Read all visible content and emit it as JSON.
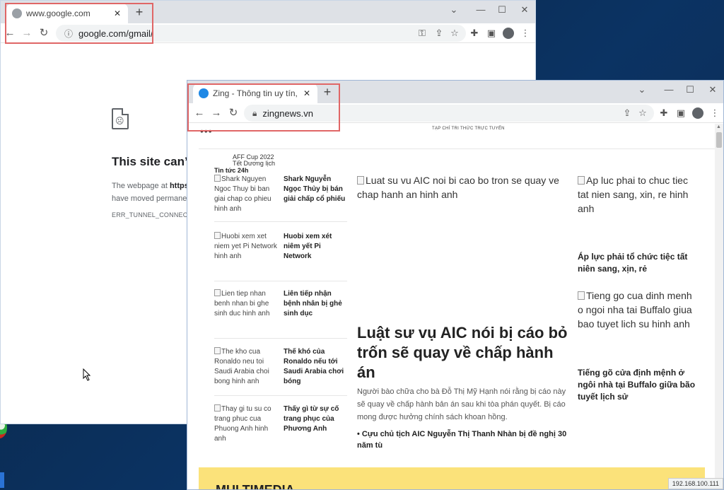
{
  "google_window": {
    "tab_title": "www.google.com",
    "url": "google.com/gmail/",
    "error": {
      "title": "This site can’t",
      "line1_prefix": "The webpage at ",
      "line1_bold": "https",
      "line2": "have moved permane",
      "code": "ERR_TUNNEL_CONNECTION"
    }
  },
  "zing_window": {
    "tab_title": "Zing - Thông tin uy tín, hình ảnh",
    "url": "zingnews.vn",
    "page": {
      "slogan": "TẠP CHÍ TRI THỨC TRỰC TUYẾN",
      "dots": "•••",
      "hot_topic_1": "AFF Cup 2022",
      "hot_topic_2": "Tết Dương lịch",
      "column_title": "Tin tức 24h",
      "items": [
        {
          "alt": "Shark Nguyen Ngoc Thuy bi ban giai chap co phieu hinh anh",
          "title": "Shark Nguyễn Ngọc Thủy bị bán giải chấp cổ phiếu"
        },
        {
          "alt": "Huobi xem xet niem yet Pi Network hinh anh",
          "title": "Huobi xem xét niêm yết Pi Network"
        },
        {
          "alt": "Lien tiep nhan benh nhan bi ghe sinh duc hinh anh",
          "title": "Liên tiếp nhận bệnh nhân bị ghẻ sinh dục"
        },
        {
          "alt": "The kho cua Ronaldo neu toi Saudi Arabia choi bong hinh anh",
          "title": "Thế khó của Ronaldo nếu tới Saudi Arabia chơi bóng"
        },
        {
          "alt": "Thay gi tu su co trang phuc cua Phuong Anh hinh anh",
          "title": "Thấy gì từ sự cố trang phục của Phương Anh"
        }
      ],
      "main": {
        "image_alt": "Luat su vu AIC noi bi cao bo tron se quay ve chap hanh an hinh anh",
        "headline": "Luật sư vụ AIC nói bị cáo bỏ trốn sẽ quay về chấp hành án",
        "sapo": "Người bào chữa cho bà Đỗ Thị Mỹ Hạnh nói rằng bị cáo này sẽ quay về chấp hành bản án sau khi tòa phán quyết. Bị cáo mong được hưởng chính sách khoan hồng.",
        "related": "• Cựu chủ tịch AIC Nguyễn Thị Thanh Nhàn bị đề nghị 30 năm tù"
      },
      "side": [
        {
          "alt": "Ap luc phai to chuc tiec tat nien sang, xin, re hinh anh",
          "title": "Áp lực phải tổ chức tiệc tất niên sang, xịn, rẻ"
        },
        {
          "alt": "Tieng go cua dinh menh o ngoi nha tai Buffalo giua bao tuyet lich su hinh anh",
          "title": "Tiếng gõ cửa định mệnh ở ngôi nhà tại Buffalo giữa bão tuyết lịch sử"
        }
      ],
      "multimedia": "MULTIMEDIA",
      "status_tip": "192.168.100.111"
    }
  },
  "colors": {
    "highlight": "#e06666",
    "zing_favicon": "#1e88e5",
    "multimedia_bar": "#fbe27a"
  },
  "icons": {
    "back": "back-arrow-icon",
    "forward": "forward-arrow-icon",
    "reload": "reload-icon",
    "key": "key-icon",
    "share": "share-icon",
    "star": "star-icon",
    "extensions": "puzzle-icon",
    "sidepanel": "side-panel-icon",
    "profile": "profile-icon",
    "menu": "kebab-menu-icon"
  }
}
